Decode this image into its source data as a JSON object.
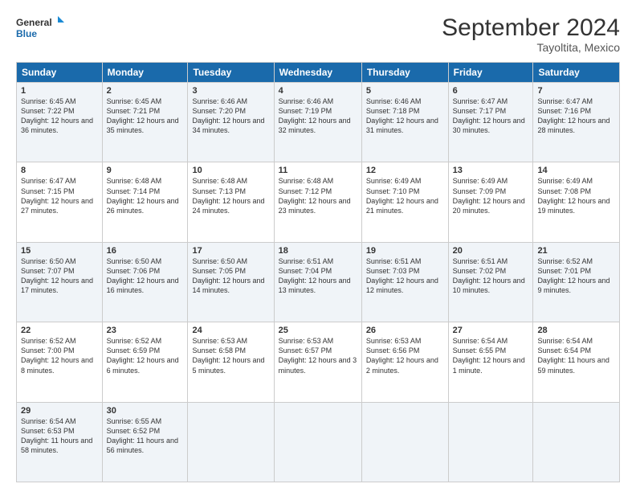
{
  "header": {
    "logo_line1": "General",
    "logo_line2": "Blue",
    "title": "September 2024",
    "subtitle": "Tayoltita, Mexico"
  },
  "weekdays": [
    "Sunday",
    "Monday",
    "Tuesday",
    "Wednesday",
    "Thursday",
    "Friday",
    "Saturday"
  ],
  "weeks": [
    [
      {
        "day": "1",
        "sunrise": "6:45 AM",
        "sunset": "7:22 PM",
        "daylight": "12 hours and 36 minutes."
      },
      {
        "day": "2",
        "sunrise": "6:45 AM",
        "sunset": "7:21 PM",
        "daylight": "12 hours and 35 minutes."
      },
      {
        "day": "3",
        "sunrise": "6:46 AM",
        "sunset": "7:20 PM",
        "daylight": "12 hours and 34 minutes."
      },
      {
        "day": "4",
        "sunrise": "6:46 AM",
        "sunset": "7:19 PM",
        "daylight": "12 hours and 32 minutes."
      },
      {
        "day": "5",
        "sunrise": "6:46 AM",
        "sunset": "7:18 PM",
        "daylight": "12 hours and 31 minutes."
      },
      {
        "day": "6",
        "sunrise": "6:47 AM",
        "sunset": "7:17 PM",
        "daylight": "12 hours and 30 minutes."
      },
      {
        "day": "7",
        "sunrise": "6:47 AM",
        "sunset": "7:16 PM",
        "daylight": "12 hours and 28 minutes."
      }
    ],
    [
      {
        "day": "8",
        "sunrise": "6:47 AM",
        "sunset": "7:15 PM",
        "daylight": "12 hours and 27 minutes."
      },
      {
        "day": "9",
        "sunrise": "6:48 AM",
        "sunset": "7:14 PM",
        "daylight": "12 hours and 26 minutes."
      },
      {
        "day": "10",
        "sunrise": "6:48 AM",
        "sunset": "7:13 PM",
        "daylight": "12 hours and 24 minutes."
      },
      {
        "day": "11",
        "sunrise": "6:48 AM",
        "sunset": "7:12 PM",
        "daylight": "12 hours and 23 minutes."
      },
      {
        "day": "12",
        "sunrise": "6:49 AM",
        "sunset": "7:10 PM",
        "daylight": "12 hours and 21 minutes."
      },
      {
        "day": "13",
        "sunrise": "6:49 AM",
        "sunset": "7:09 PM",
        "daylight": "12 hours and 20 minutes."
      },
      {
        "day": "14",
        "sunrise": "6:49 AM",
        "sunset": "7:08 PM",
        "daylight": "12 hours and 19 minutes."
      }
    ],
    [
      {
        "day": "15",
        "sunrise": "6:50 AM",
        "sunset": "7:07 PM",
        "daylight": "12 hours and 17 minutes."
      },
      {
        "day": "16",
        "sunrise": "6:50 AM",
        "sunset": "7:06 PM",
        "daylight": "12 hours and 16 minutes."
      },
      {
        "day": "17",
        "sunrise": "6:50 AM",
        "sunset": "7:05 PM",
        "daylight": "12 hours and 14 minutes."
      },
      {
        "day": "18",
        "sunrise": "6:51 AM",
        "sunset": "7:04 PM",
        "daylight": "12 hours and 13 minutes."
      },
      {
        "day": "19",
        "sunrise": "6:51 AM",
        "sunset": "7:03 PM",
        "daylight": "12 hours and 12 minutes."
      },
      {
        "day": "20",
        "sunrise": "6:51 AM",
        "sunset": "7:02 PM",
        "daylight": "12 hours and 10 minutes."
      },
      {
        "day": "21",
        "sunrise": "6:52 AM",
        "sunset": "7:01 PM",
        "daylight": "12 hours and 9 minutes."
      }
    ],
    [
      {
        "day": "22",
        "sunrise": "6:52 AM",
        "sunset": "7:00 PM",
        "daylight": "12 hours and 8 minutes."
      },
      {
        "day": "23",
        "sunrise": "6:52 AM",
        "sunset": "6:59 PM",
        "daylight": "12 hours and 6 minutes."
      },
      {
        "day": "24",
        "sunrise": "6:53 AM",
        "sunset": "6:58 PM",
        "daylight": "12 hours and 5 minutes."
      },
      {
        "day": "25",
        "sunrise": "6:53 AM",
        "sunset": "6:57 PM",
        "daylight": "12 hours and 3 minutes."
      },
      {
        "day": "26",
        "sunrise": "6:53 AM",
        "sunset": "6:56 PM",
        "daylight": "12 hours and 2 minutes."
      },
      {
        "day": "27",
        "sunrise": "6:54 AM",
        "sunset": "6:55 PM",
        "daylight": "12 hours and 1 minute."
      },
      {
        "day": "28",
        "sunrise": "6:54 AM",
        "sunset": "6:54 PM",
        "daylight": "11 hours and 59 minutes."
      }
    ],
    [
      {
        "day": "29",
        "sunrise": "6:54 AM",
        "sunset": "6:53 PM",
        "daylight": "11 hours and 58 minutes."
      },
      {
        "day": "30",
        "sunrise": "6:55 AM",
        "sunset": "6:52 PM",
        "daylight": "11 hours and 56 minutes."
      },
      null,
      null,
      null,
      null,
      null
    ]
  ]
}
